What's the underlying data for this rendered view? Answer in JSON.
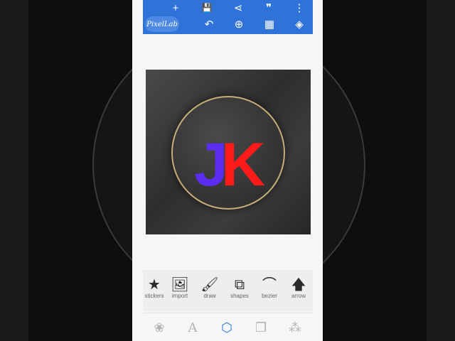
{
  "app": {
    "logo_text": "PixelLab",
    "accent_color": "#2f73d8"
  },
  "appbar": {
    "row1": [
      {
        "icon": "plus-icon",
        "glyph": "+"
      },
      {
        "icon": "save-icon",
        "glyph": "💾"
      },
      {
        "icon": "share-icon",
        "glyph": "⋖"
      },
      {
        "icon": "quote-icon",
        "glyph": "❞"
      },
      {
        "icon": "more-icon",
        "glyph": "⋮"
      }
    ],
    "row2": [
      {
        "icon": "undo-icon",
        "glyph": "↶"
      },
      {
        "icon": "zoom-icon",
        "glyph": "⊕"
      },
      {
        "icon": "grid-icon",
        "glyph": "▦"
      },
      {
        "icon": "layers-icon",
        "glyph": "◈"
      }
    ]
  },
  "artwork": {
    "letter_j": "J",
    "letter_k": "K",
    "j_color": "#5a2df0",
    "k_color": "#ff1a1a"
  },
  "toolbar": {
    "tools": [
      {
        "label": "stickers",
        "icon": "star-plus-icon",
        "glyph": "★"
      },
      {
        "label": "import",
        "icon": "image-icon",
        "glyph": "🖼"
      },
      {
        "label": "draw",
        "icon": "brush-icon",
        "glyph": "🖌"
      },
      {
        "label": "shapes",
        "icon": "shapes-icon",
        "glyph": "⧉"
      },
      {
        "label": "bezier",
        "icon": "bezier-icon",
        "glyph": "⌒"
      },
      {
        "label": "arrow",
        "icon": "arrow-up-icon",
        "glyph": "🡅"
      }
    ]
  },
  "bottomnav": [
    {
      "icon": "effects-icon",
      "glyph": "❀"
    },
    {
      "icon": "text-icon",
      "glyph": "A"
    },
    {
      "icon": "hexagon-icon",
      "glyph": "⬡"
    },
    {
      "icon": "copy-icon",
      "glyph": "❐"
    },
    {
      "icon": "magic-wand-icon",
      "glyph": "⁂"
    }
  ]
}
